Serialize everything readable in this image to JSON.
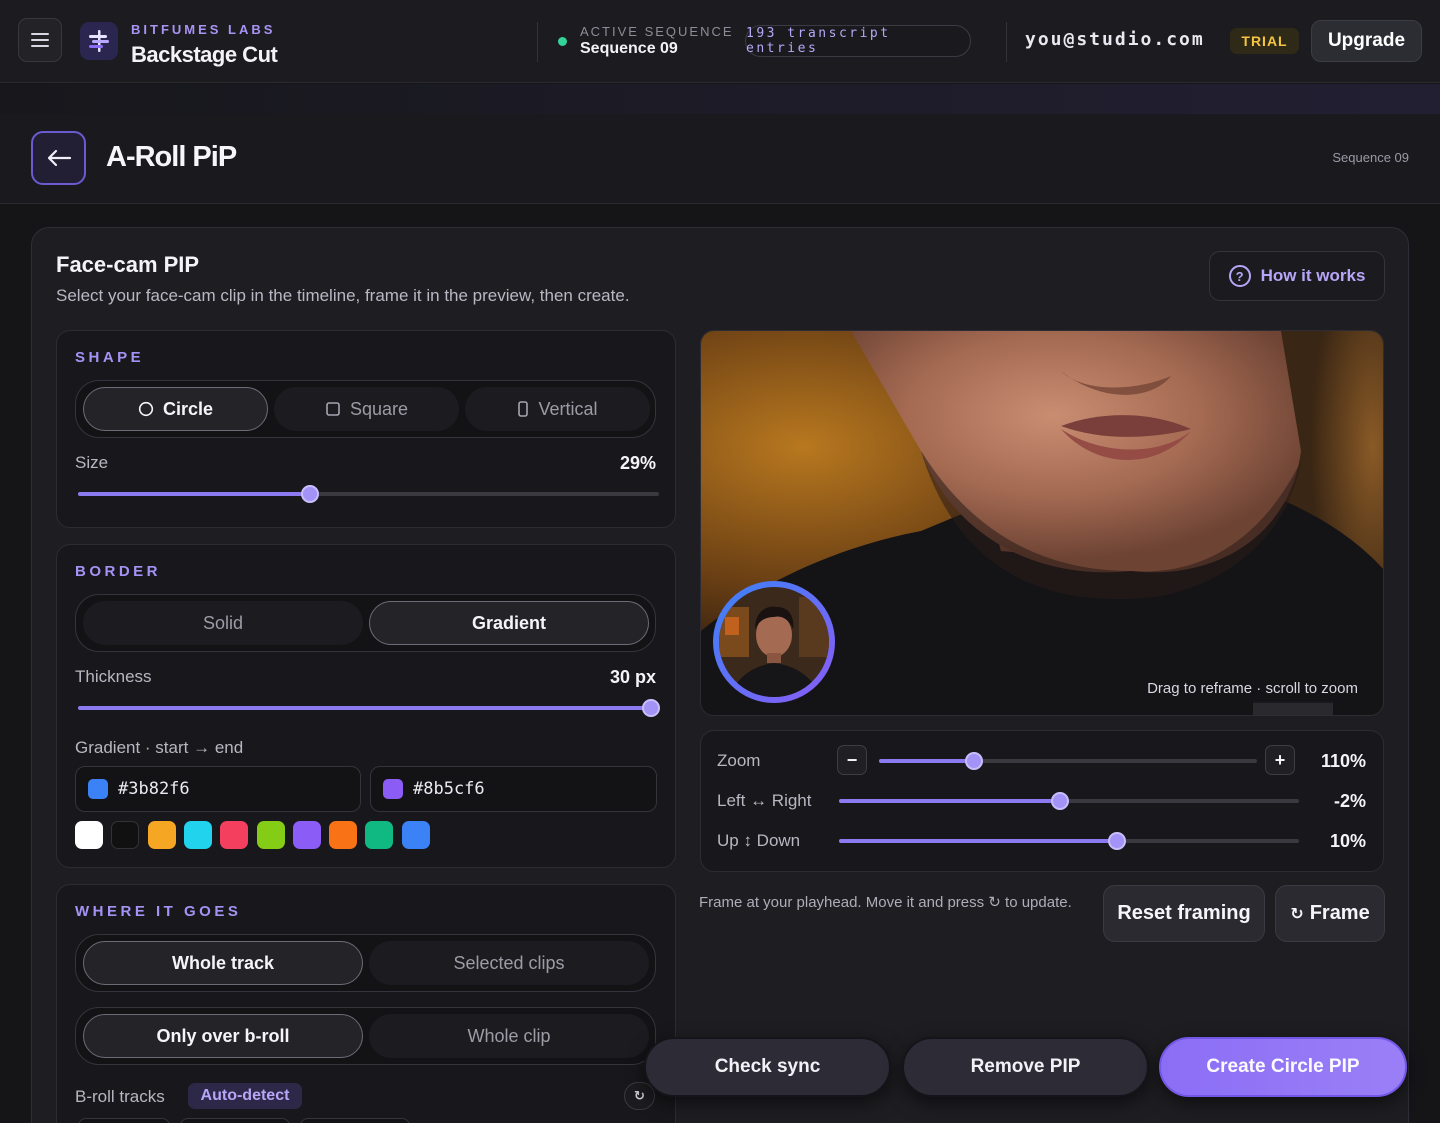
{
  "topbar": {
    "org": "BITFUMES LABS",
    "app": "Backstage Cut",
    "sequence_label": "ACTIVE SEQUENCE",
    "sequence_name": "Sequence 09",
    "transcript_count": "193 transcript entries",
    "email": "you@studio.com",
    "plan_badge": "TRIAL",
    "upgrade_label": "Upgrade"
  },
  "page": {
    "back_icon": "arrow-left-icon",
    "title": "A-Roll PiP",
    "sequence": "Sequence 09"
  },
  "card": {
    "title": "Face-cam PIP",
    "subtitle": "Select your face-cam clip in the timeline, frame it in the preview, then create.",
    "help_label": "How it works"
  },
  "shape": {
    "label": "SHAPE",
    "options": [
      {
        "label": "Circle",
        "icon": "circle-icon",
        "active": true
      },
      {
        "label": "Square",
        "icon": "square-icon",
        "active": false
      },
      {
        "label": "Vertical",
        "icon": "vertical-rect-icon",
        "active": false
      }
    ],
    "size_label": "Size",
    "size_value": "29%",
    "size_fraction": 0.4
  },
  "border": {
    "label": "BORDER",
    "options": [
      {
        "label": "Solid",
        "active": false
      },
      {
        "label": "Gradient",
        "active": true
      }
    ],
    "thickness_label": "Thickness",
    "thickness_value": "30 px",
    "thickness_fraction": 1.0,
    "gradient_label": "Gradient · start → end",
    "start_color": "#3b82f6",
    "end_color": "#8b5cf6",
    "swatches": [
      "#ffffff",
      "#111111",
      "#f5a623",
      "#22d3ee",
      "#f43f5e",
      "#84cc16",
      "#8b5cf6",
      "#f97316",
      "#10b981",
      "#3b82f6"
    ]
  },
  "placement": {
    "label": "WHERE IT GOES",
    "scope_options": [
      {
        "label": "Whole track",
        "active": true
      },
      {
        "label": "Selected clips",
        "active": false
      }
    ],
    "range_options": [
      {
        "label": "Only over b-roll",
        "active": true
      },
      {
        "label": "Whole clip",
        "active": false
      }
    ],
    "broll_label": "B-roll tracks",
    "broll_badge": "Auto-detect",
    "refresh_icon": "refresh-icon"
  },
  "preview": {
    "hint": "Drag to reframe · scroll to zoom"
  },
  "framing": {
    "zoom_label": "Zoom",
    "zoom_value": "110%",
    "zoom_fraction": 0.25,
    "lr_label": "Left ↔ Right",
    "lr_value": "-2%",
    "lr_fraction": 0.48,
    "ud_label": "Up ↕ Down",
    "ud_value": "10%",
    "ud_fraction": 0.605,
    "minus": "−",
    "plus": "+",
    "note": "Frame at your playhead. Move it and press ↻ to update.",
    "reset_label": "Reset framing",
    "frame_label": "Frame",
    "frame_icon": "↻"
  },
  "actions": {
    "check_sync": "Check sync",
    "remove": "Remove PIP",
    "create": "Create Circle PIP"
  },
  "colors": {
    "accent": "#8b7af0",
    "accent_text": "#a592f5",
    "status_green": "#34d399",
    "trial": "#f5c542"
  }
}
